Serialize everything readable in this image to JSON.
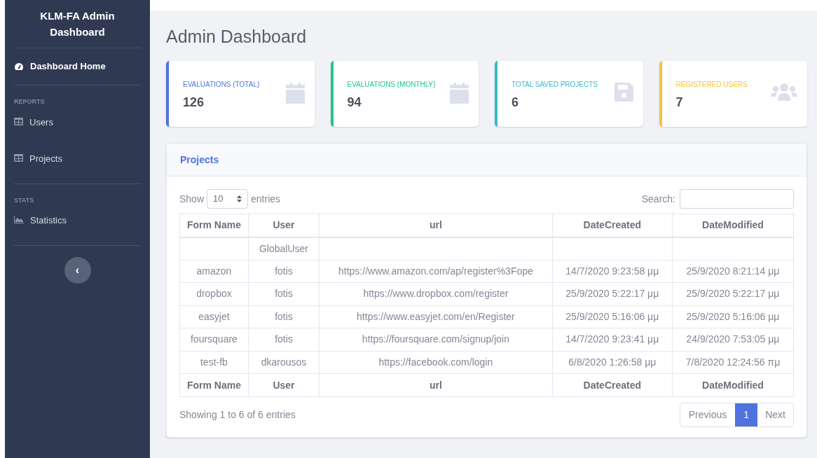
{
  "sidebar": {
    "brand": [
      "KLM-FA Admin",
      "Dashboard"
    ],
    "sections": [
      {
        "items": [
          {
            "label": "Dashboard Home",
            "selected": true
          }
        ]
      },
      {
        "heading": "REPORTS",
        "items": [
          {
            "label": "Users",
            "selected": false
          },
          {
            "label": "Projects",
            "selected": false
          }
        ]
      },
      {
        "heading": "STATS",
        "items": [
          {
            "label": "Statistics",
            "selected": false
          }
        ]
      }
    ],
    "toggle": "‹"
  },
  "page_title": "Admin Dashboard",
  "cards": [
    {
      "label": "EVALUATIONS (TOTAL)",
      "value": "126",
      "color": "#4e73df"
    },
    {
      "label": "EVALUATIONS (MONTHLY)",
      "value": "94",
      "color": "#1cc88a"
    },
    {
      "label": "TOTAL SAVED PROJECTS",
      "value": "6",
      "color": "#36b9cc"
    },
    {
      "label": "REGISTERED USERS",
      "value": "7",
      "color": "#f6c23e"
    }
  ],
  "projects": {
    "title": "Projects",
    "show_label": "Show",
    "page_size": "10",
    "entries_label": "entries",
    "search_label": "Search:",
    "columns": [
      "Form Name",
      "User",
      "url",
      "DateCreated",
      "DateModified"
    ],
    "rows": [
      [
        "",
        "GlobalUser",
        "",
        "",
        ""
      ],
      [
        "amazon",
        "fotis",
        "https://www.amazon.com/ap/register%3Fope",
        "14/7/2020 9:23:58 μμ",
        "25/9/2020 8:21:14 μμ"
      ],
      [
        "dropbox",
        "fotis",
        "https://www.dropbox.com/register",
        "25/9/2020 5:22:17 μμ",
        "25/9/2020 5:22:17 μμ"
      ],
      [
        "easyjet",
        "fotis",
        "https://www.easyjet.com/en/Register",
        "25/9/2020 5:16:06 μμ",
        "25/9/2020 5:16:06 μμ"
      ],
      [
        "foursquare",
        "fotis",
        "https://foursquare.com/signup/join",
        "14/7/2020 9:23:41 μμ",
        "24/9/2020 7:53:05 μμ"
      ],
      [
        "test-fb",
        "dkarousos",
        "https://facebook.com/login",
        "6/8/2020 1:26:58 μμ",
        "7/8/2020 12:24:56 πμ"
      ]
    ],
    "footer_columns": [
      "Form Name",
      "User",
      "url",
      "DateCreated",
      "DateModified"
    ],
    "info": "Showing 1 to 6 of 6 entries",
    "pagination": {
      "previous": "Previous",
      "pages": [
        {
          "label": "1",
          "selected": true
        }
      ],
      "next": "Next"
    }
  }
}
